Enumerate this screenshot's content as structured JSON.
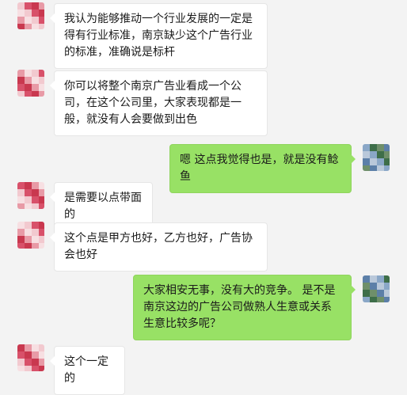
{
  "colors": {
    "background": "#f3f3f3",
    "incoming_bubble": "#ffffff",
    "outgoing_bubble": "#98e165"
  },
  "messages": [
    {
      "side": "in",
      "text": "我认为能够推动一个行业发展的一定是得有行业标准，南京缺少这个广告行业的标准，准确说是标杆"
    },
    {
      "side": "in",
      "text": "你可以将整个南京广告业看成一个公司，在这个公司里，大家表现都是一般，就没有人会要做到出色"
    },
    {
      "side": "out",
      "text": "嗯 这点我觉得也是，就是没有鲶鱼"
    },
    {
      "side": "in",
      "text": "是需要以点带面的"
    },
    {
      "side": "in",
      "text": "这个点是甲方也好，乙方也好，广告协会也好"
    },
    {
      "side": "out",
      "text": "大家相安无事，没有大的竞争。 是不是南京这边的广告公司做熟人生意或关系生意比较多呢？"
    },
    {
      "side": "in",
      "text": "这个一定的"
    }
  ],
  "avatars": {
    "incoming": {
      "name": "blurred-avatar-pink",
      "palette": [
        "#f2c9cf",
        "#e89aa6",
        "#d8516a",
        "#f7dfe2",
        "#c9384f"
      ]
    },
    "outgoing": {
      "name": "blurred-avatar-blue-green",
      "palette": [
        "#8aa7c7",
        "#5c7fa8",
        "#3e6e49",
        "#b9c8da",
        "#6f8f6a"
      ]
    }
  }
}
